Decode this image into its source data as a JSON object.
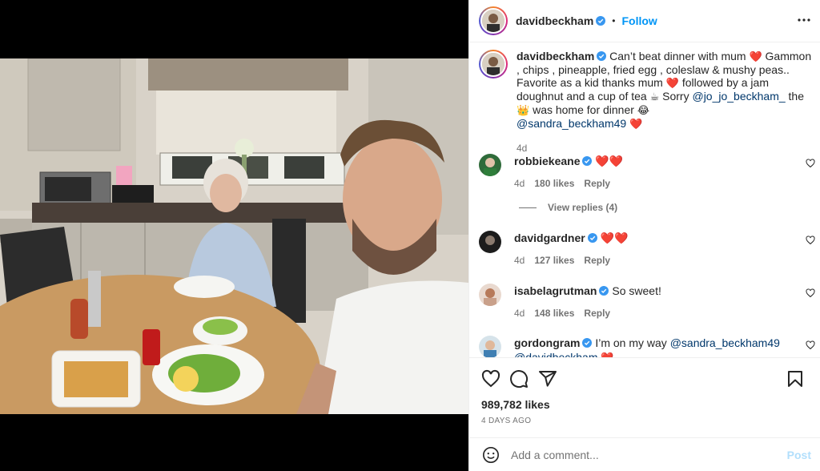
{
  "post": {
    "username": "davidbeckham",
    "follow_label": "Follow",
    "dot": "•"
  },
  "caption": {
    "username": "davidbeckham",
    "part1": " Can’t beat dinner with mum ",
    "part2": " Gammon , chips , pineapple, fried egg , coleslaw & mushy peas.. Favorite as a kid thanks mum ",
    "part3": " followed by a jam doughnut and a cup of tea ",
    "part4": " Sorry ",
    "mention1": "@jo_jo_beckham_",
    "part5": " the ",
    "part6": " was home for dinner ",
    "mention2": "@sandra_beckham49",
    "emoji_heart": "❤️",
    "emoji_tea": "☕",
    "emoji_crown": "👑",
    "emoji_laugh": "😂",
    "time": "4d"
  },
  "comments": [
    {
      "username": "robbiekeane",
      "text": "❤️❤️",
      "time": "4d",
      "likes": "180 likes",
      "reply": "Reply",
      "view_replies": "View replies (4)"
    },
    {
      "username": "davidgardner",
      "text": "❤️❤️",
      "time": "4d",
      "likes": "127 likes",
      "reply": "Reply"
    },
    {
      "username": "isabelagrutman",
      "text": "So sweet!",
      "time": "4d",
      "likes": "148 likes",
      "reply": "Reply"
    },
    {
      "username": "gordongram",
      "text": "I’m on my way ",
      "mention": "@sandra_beckham49",
      "mention2": "@davidbeckham",
      "emoji": "❤️"
    }
  ],
  "actions": {
    "likes": "989,782 likes",
    "posted": "4 DAYS AGO"
  },
  "add_comment": {
    "placeholder": "Add a comment...",
    "post_label": "Post"
  },
  "colors": {
    "accent": "#0095f6",
    "verified": "#3897f0",
    "muted": "#737373"
  }
}
